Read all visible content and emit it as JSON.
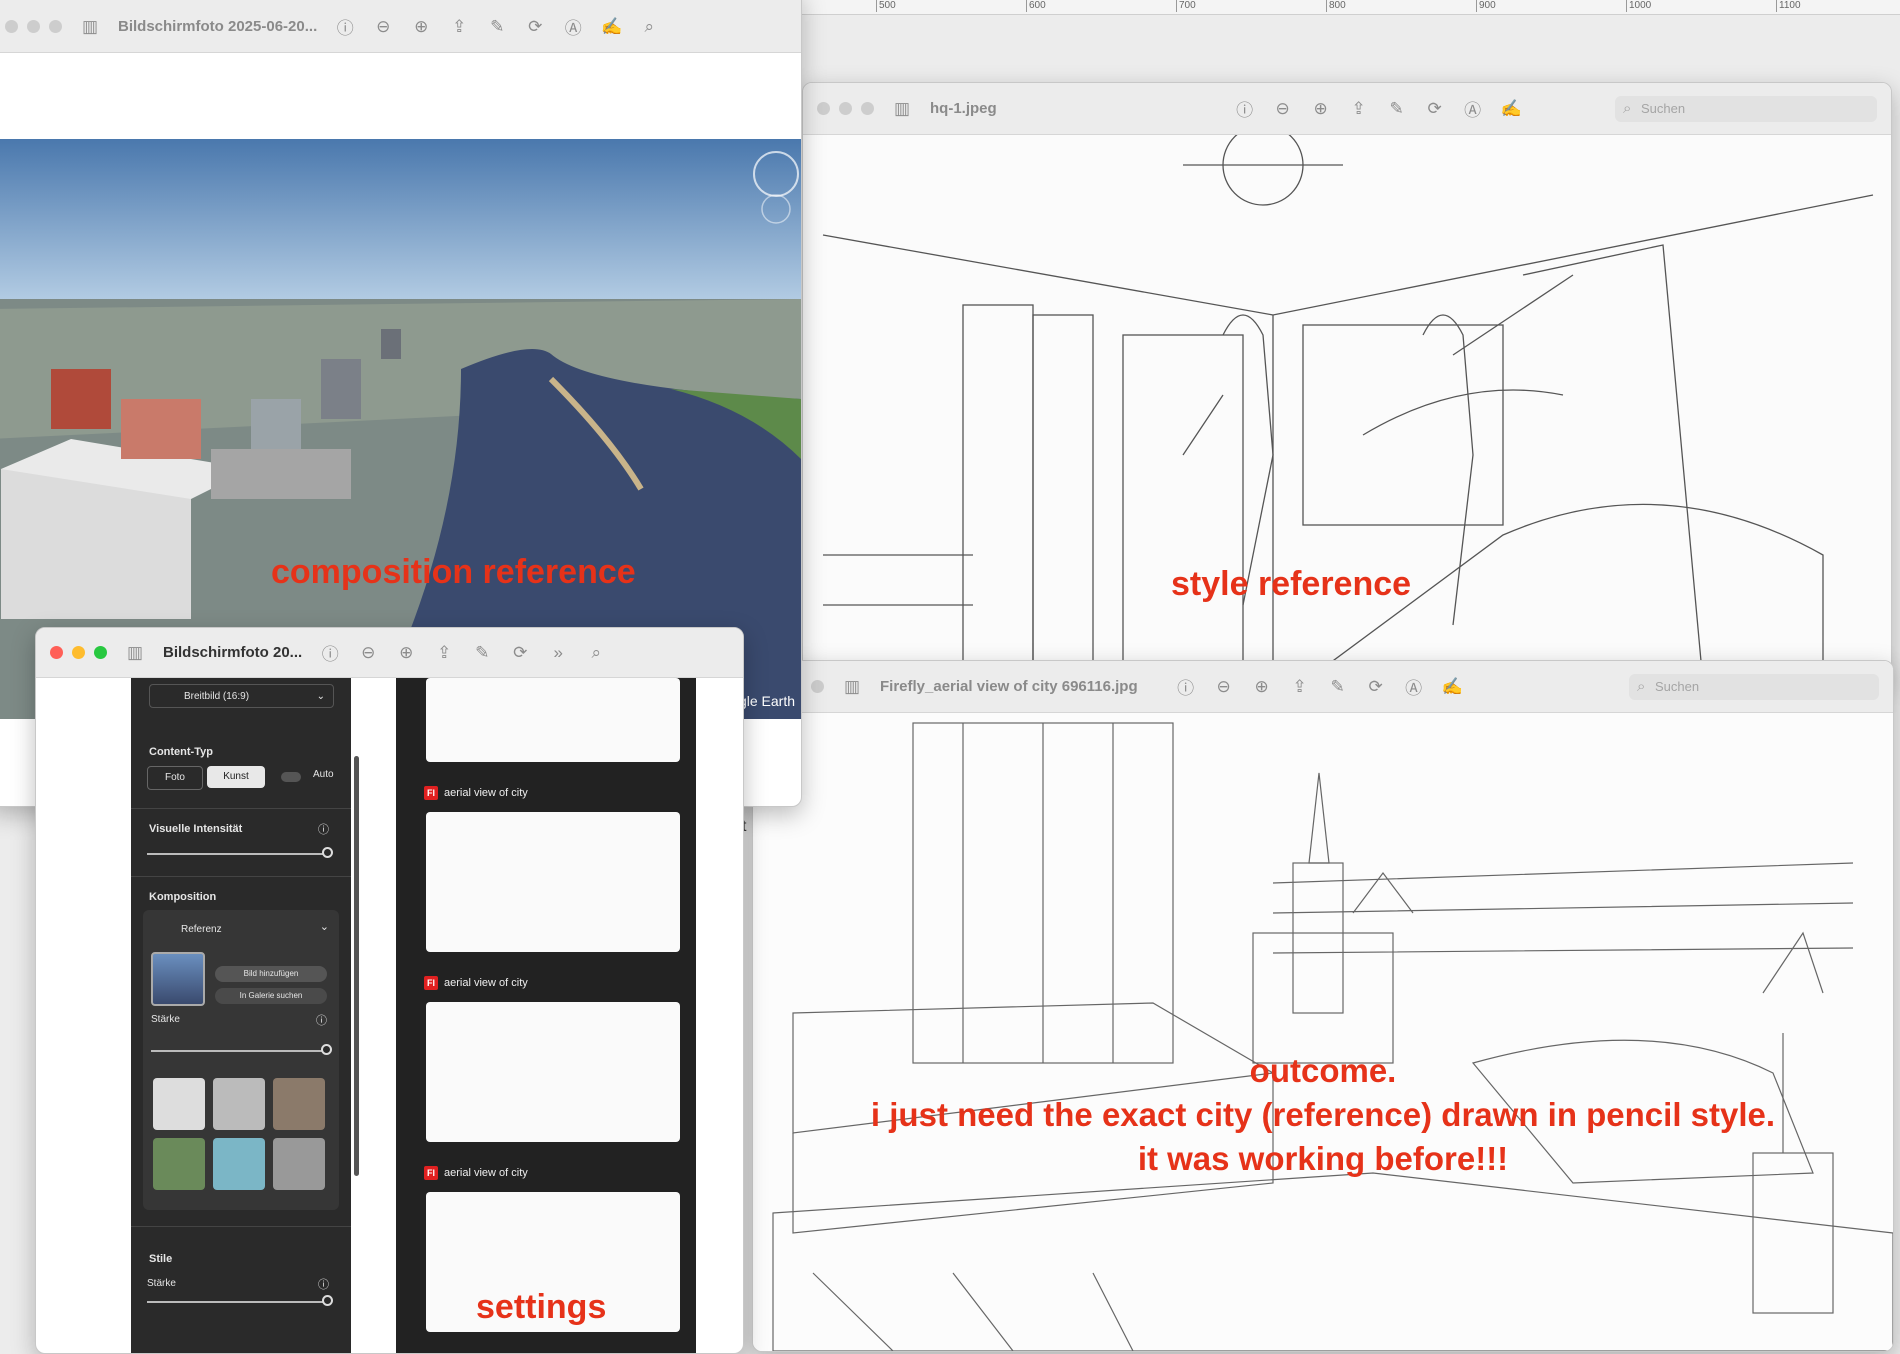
{
  "ruler": {
    "ticks": [
      "500",
      "600",
      "700",
      "800",
      "900",
      "1000",
      "1100"
    ]
  },
  "win1": {
    "title": "Bildschirmfoto 2025-06-20...",
    "attribution": "Google Earth",
    "label": "composition reference"
  },
  "win2": {
    "title": "hq-1.jpeg",
    "search_placeholder": "Suchen",
    "label": "style reference"
  },
  "win3": {
    "title": "Firefly_aerial view of city 696116.jpg",
    "search_placeholder": "Suchen",
    "label_line1": "outcome.",
    "label_line2": "i just need the exact city (reference) drawn in pencil style.",
    "label_line3": "it was working before!!!"
  },
  "win4": {
    "title": "Bildschirmfoto 20...",
    "aspect": "Breitbild (16:9)",
    "content_type": {
      "heading": "Content-Typ",
      "photo": "Foto",
      "art": "Kunst",
      "auto": "Auto"
    },
    "visual_intensity": {
      "heading": "Visuelle Intensität",
      "value": 1.0
    },
    "composition": {
      "heading": "Komposition",
      "reference": "Referenz",
      "add_image": "Bild hinzufügen",
      "search_gallery": "In Galerie suchen",
      "strength_label": "Stärke",
      "strength": 1.0
    },
    "styles": {
      "heading": "Stile",
      "strength_label": "Stärke",
      "strength": 1.0
    },
    "results": [
      {
        "label": "aerial view of city"
      },
      {
        "label": "aerial view of city"
      },
      {
        "label": "aerial view of city"
      }
    ],
    "overlay_label": "settings",
    "stray_text": "t"
  },
  "colors": {
    "annotation": "#e63219",
    "panel_bg": "#2a2a2a",
    "sky": "#5b87b8",
    "river": "#3a4a6e"
  }
}
